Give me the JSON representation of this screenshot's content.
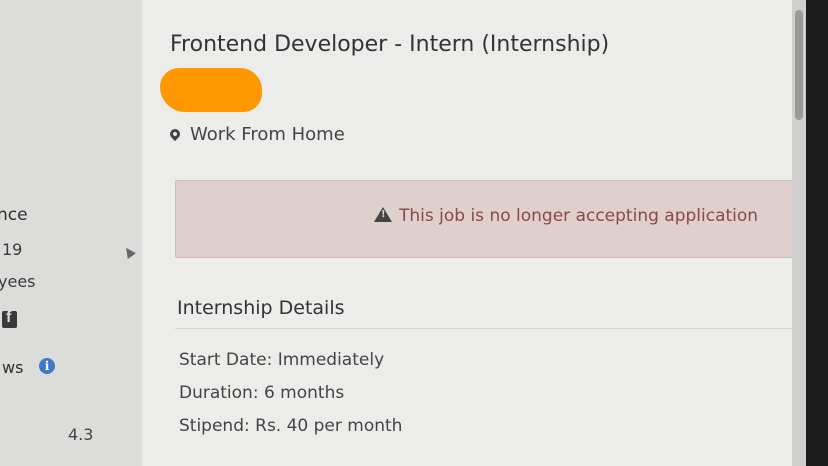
{
  "sidebar": {
    "fragment_ce": "nce",
    "fragment_19": "19",
    "fragment_yees": "yees",
    "fragment_ws": "ws",
    "rating": "4.3"
  },
  "job": {
    "title": "Frontend Developer - Intern (Internship)",
    "location": "Work From Home"
  },
  "alert": {
    "message": "This job is no longer accepting application"
  },
  "details": {
    "section_title": "Internship Details",
    "start_date": "Start Date: Immediately",
    "duration": "Duration: 6 months",
    "stipend": "Stipend: Rs. 40 per month"
  },
  "colors": {
    "alert_bg": "#dfcfcd",
    "alert_text": "#8a4a45",
    "redaction": "#ff9800",
    "info_icon": "#3f78c4"
  },
  "icons": [
    "location-pin-icon",
    "warning-icon",
    "facebook-icon",
    "info-icon",
    "mouse-cursor-icon"
  ]
}
